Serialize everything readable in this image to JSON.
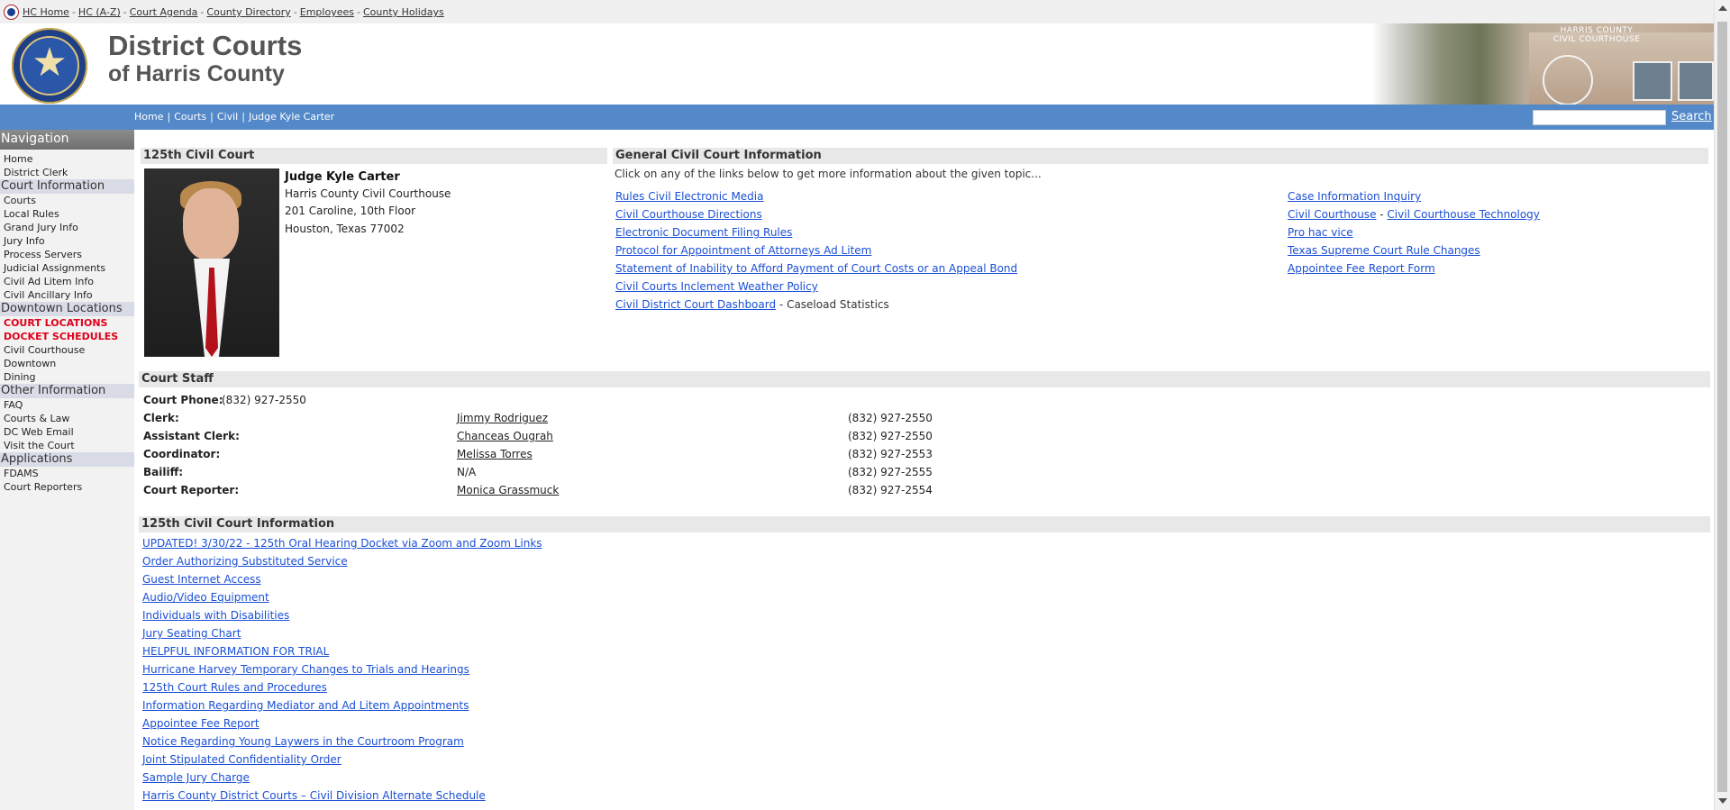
{
  "topbar": {
    "links": [
      "HC Home",
      "HC (A-Z)",
      "Court Agenda",
      "County Directory",
      "Employees",
      "County Holidays"
    ],
    "separator": "-"
  },
  "header": {
    "title_line1": "District Courts",
    "title_line2": "of Harris County",
    "photo_caption_line1": "HARRIS COUNTY",
    "photo_caption_line2": "CIVIL COURTHOUSE"
  },
  "navbar": {
    "crumbs": [
      "Home",
      "Courts",
      "Civil",
      "Judge Kyle Carter"
    ],
    "separator": "|",
    "search_value": "",
    "search_label": "Search"
  },
  "sidebar": {
    "title": "Navigation",
    "top_items": [
      "Home",
      "District Clerk"
    ],
    "sections": [
      {
        "label": "Court Information",
        "items": [
          "Courts",
          "Local Rules",
          "Grand Jury Info",
          "Jury Info",
          "Process Servers",
          "Judicial Assignments",
          "Civil Ad Litem Info",
          "Civil Ancillary Info"
        ]
      },
      {
        "label": "Downtown Locations",
        "items": [
          "COURT LOCATIONS",
          "DOCKET SCHEDULES",
          "Civil Courthouse",
          "Downtown",
          "Dining"
        ]
      },
      {
        "label": "Other Information",
        "items": [
          "FAQ",
          "Courts & Law",
          "DC Web Email",
          "Visit the Court"
        ]
      },
      {
        "label": "Applications",
        "items": [
          "FDAMS",
          "Court Reporters"
        ]
      }
    ]
  },
  "court": {
    "heading": "125th Civil Court",
    "judge_name": "Judge Kyle Carter",
    "address": [
      "Harris County Civil Courthouse",
      "201 Caroline, 10th Floor",
      "Houston, Texas 77002"
    ]
  },
  "general": {
    "heading": "General Civil Court Information",
    "intro": "Click on any of the links below to get more information about the given topic...",
    "left_links": [
      "Rules Civil Electronic Media",
      "Civil Courthouse Directions",
      "Electronic Document Filing Rules",
      "Protocol for Appointment of Attorneys Ad Litem",
      "Statement of Inability to Afford Payment of Court Costs or an Appeal Bond",
      "Civil Courts Inclement Weather Policy",
      "Civil District Court Dashboard"
    ],
    "dashboard_suffix": " - Caseload Statistics",
    "right_links": [
      "Case Information Inquiry",
      "Civil Courthouse",
      "Civil Courthouse Technology",
      "Pro hac vice",
      "Texas Supreme Court Rule Changes",
      "Appointee Fee Report Form"
    ],
    "right_sep": " - "
  },
  "staff": {
    "heading": "Court Staff",
    "phone_label": "Court Phone:",
    "phone_value": "(832) 927-2550",
    "rows": [
      {
        "role": "Clerk:",
        "name": "Jimmy Rodriguez",
        "phone": "(832) 927-2550"
      },
      {
        "role": "Assistant Clerk:",
        "name": "Chanceas Ougrah",
        "phone": "(832) 927-2550"
      },
      {
        "role": "Coordinator:",
        "name": "Melissa Torres",
        "phone": "(832) 927-2553"
      },
      {
        "role": "Bailiff:",
        "name": "N/A",
        "phone": "(832) 927-2555"
      },
      {
        "role": "Court Reporter:",
        "name": "Monica Grassmuck",
        "phone": "(832) 927-2554"
      }
    ]
  },
  "info": {
    "heading": "125th Civil Court Information",
    "links": [
      "UPDATED! 3/30/22 - 125th Oral Hearing Docket via Zoom and Zoom Links",
      "Order Authorizing Substituted Service",
      "Guest Internet Access",
      "Audio/Video Equipment",
      "Individuals with Disabilities",
      "Jury Seating Chart",
      "HELPFUL INFORMATION FOR TRIAL",
      "Hurricane Harvey Temporary Changes to Trials and Hearings",
      "125th Court Rules and Procedures",
      "Information Regarding Mediator and Ad Litem Appointments",
      "Appointee Fee Report",
      "Notice Regarding Young Laywers in the Courtroom Program",
      "Joint Stipulated Confidentiality Order",
      "Sample Jury Charge",
      "Harris County District Courts – Civil Division Alternate Schedule"
    ]
  }
}
